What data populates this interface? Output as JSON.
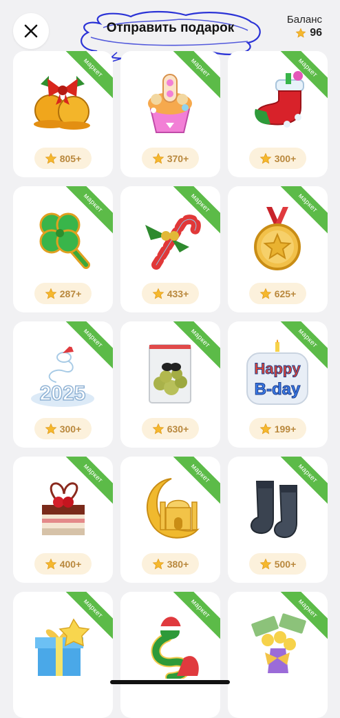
{
  "header": {
    "title": "Отправить подарок",
    "balance_label": "Баланс",
    "balance_value": "96"
  },
  "icons": {
    "close": "close-icon",
    "star": "star-icon"
  },
  "colors": {
    "ribbon": "#5cbb48",
    "price_bg": "#fcf1dc",
    "price_text": "#b9883d",
    "star": "#f5b82e",
    "scribble": "#2b33d6"
  },
  "gifts": [
    {
      "name": "jingle-bells",
      "badge": "маркет",
      "price": "805+"
    },
    {
      "name": "march-8-cupcake",
      "badge": "маркет",
      "price": "370+"
    },
    {
      "name": "christmas-stocking",
      "badge": "маркет",
      "price": "300+"
    },
    {
      "name": "clover-pin",
      "badge": "маркет",
      "price": "287+"
    },
    {
      "name": "candy-cane",
      "badge": "маркет",
      "price": "433+"
    },
    {
      "name": "gold-medal",
      "badge": "маркет",
      "price": "625+"
    },
    {
      "name": "snake-2025",
      "badge": "маркет",
      "price": "300+"
    },
    {
      "name": "bag-of-weed",
      "badge": "маркет",
      "price": "630+"
    },
    {
      "name": "happy-bday-candle",
      "badge": "маркет",
      "price": "199+",
      "art_text_1": "Happy",
      "art_text_2": "B-day"
    },
    {
      "name": "cake",
      "badge": "маркет",
      "price": "400+"
    },
    {
      "name": "crescent-mosque",
      "badge": "маркет",
      "price": "380+"
    },
    {
      "name": "socks",
      "badge": "маркет",
      "price": "500+"
    },
    {
      "name": "gift-box-2025",
      "badge": "маркет",
      "price": ""
    },
    {
      "name": "snake-in-hat",
      "badge": "маркет",
      "price": ""
    },
    {
      "name": "money-bouquet",
      "badge": "маркет",
      "price": ""
    }
  ]
}
